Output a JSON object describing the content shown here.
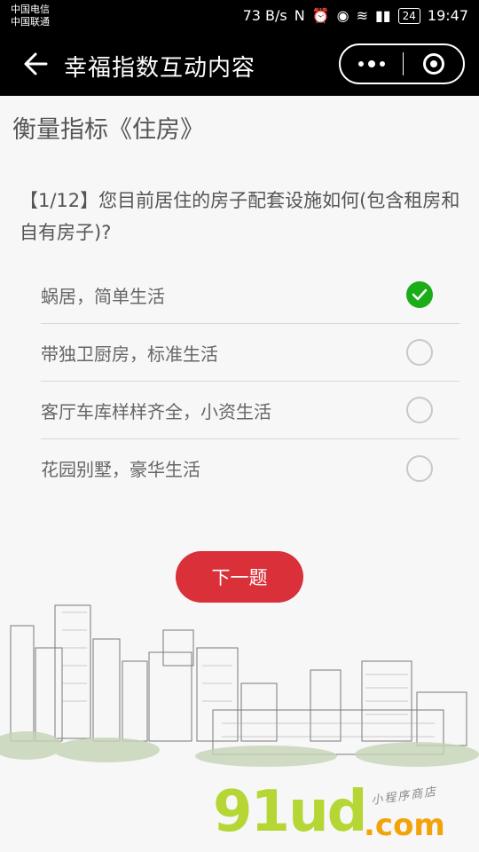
{
  "statusbar": {
    "carrier1": "中国电信",
    "carrier2": "中国联通",
    "speed": "73 B/s",
    "battery": "24",
    "time": "19:47"
  },
  "navbar": {
    "title": "幸福指数互动内容"
  },
  "section": {
    "title": "衡量指标《住房》"
  },
  "question": {
    "text": "【1/12】您目前居住的房子配套设施如何(包含租房和自有房子)?"
  },
  "options": [
    {
      "label": "蜗居，简单生活",
      "selected": true
    },
    {
      "label": "带独卫厨房，标准生活",
      "selected": false
    },
    {
      "label": "客厅车库样样齐全，小资生活",
      "selected": false
    },
    {
      "label": "花园别墅，豪华生活",
      "selected": false
    }
  ],
  "next_button": {
    "label": "下一题"
  },
  "watermark": {
    "logo": "91ud",
    "domain": ".com",
    "tagline": "小程序商店"
  },
  "colors": {
    "accent": "#d9303a",
    "check": "#1aad19",
    "bar": "#000000",
    "text": "#555555"
  }
}
